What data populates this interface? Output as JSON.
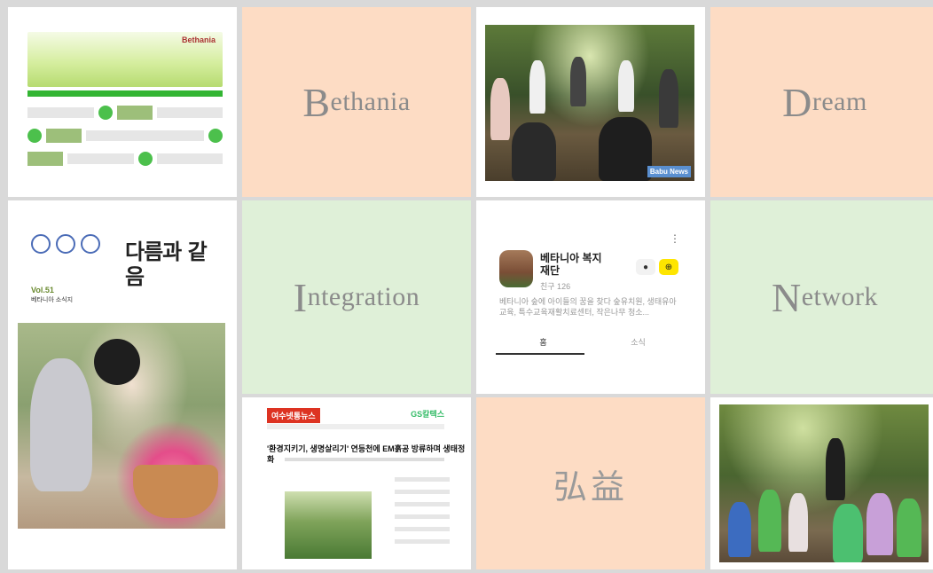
{
  "tiles": {
    "bethania": "Bethania",
    "dream": "Dream",
    "integration": "Integration",
    "network": "Network",
    "hongik": "弘益"
  },
  "website": {
    "logo_text": "Bethania"
  },
  "forest_photo": {
    "badge": "Babu News"
  },
  "kakao": {
    "name": "베타니아 복지재단",
    "friends": "친구 126",
    "description": "베타니아 숲에 아이들의 꿈을 찾다 숲유치원, 생태유아교육, 특수교육재활치료센터, 작은나무 청소...",
    "tab_home": "홈",
    "tab_news": "소식",
    "chat_icon": "chat-bubble-icon",
    "add_icon": "add-friend-icon",
    "more_icon": "more-vertical-icon"
  },
  "newsletter": {
    "title": "다름과 같음",
    "vol": "Vol.51",
    "subtitle": "베타니아 소식지"
  },
  "news": {
    "brand": "여수넷통뉴스",
    "sponsor": "GS칼텍스",
    "headline": "'환경지키기, 생명살리기' 연등천에 EM흙공 방류하며 생태정화"
  },
  "colors": {
    "peach": "#fddcc4",
    "mint": "#dff0d8",
    "word": "#8b8b8b"
  }
}
